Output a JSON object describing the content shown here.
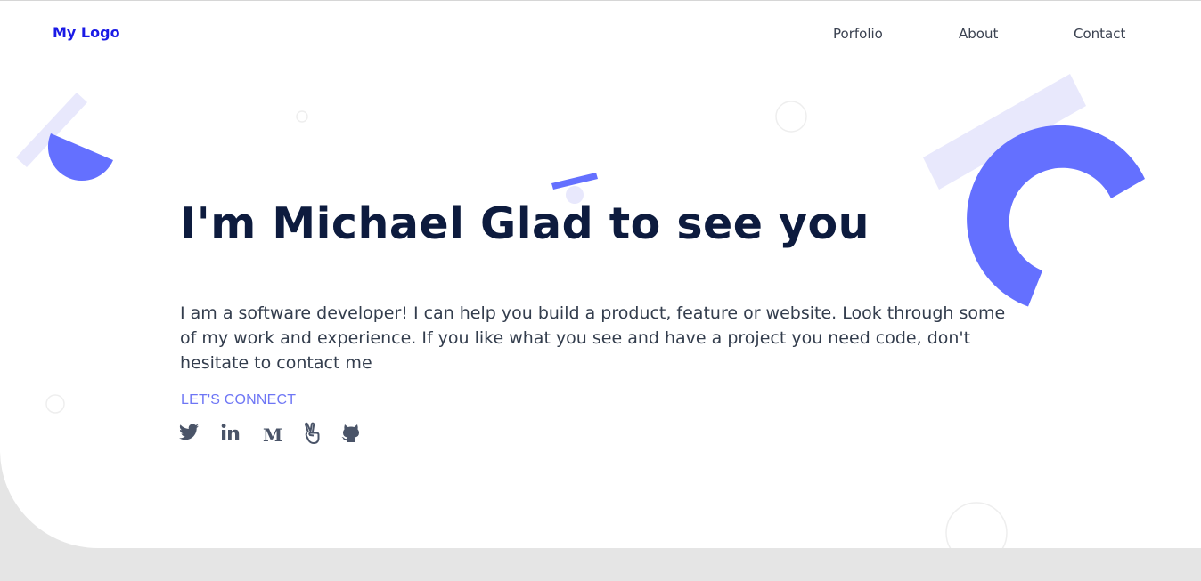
{
  "brand": {
    "logo_text": "My Logo"
  },
  "nav": {
    "items": [
      {
        "label": "Porfolio"
      },
      {
        "label": "About"
      },
      {
        "label": "Contact"
      }
    ]
  },
  "hero": {
    "headline": "I'm Michael Glad to see you",
    "intro": "I am a software developer! I can help you build a product, feature or website. Look through some of my work and experience. If you like what you see and have a project you need code, don't hesitate to contact me",
    "connect_label": "LET'S CONNECT"
  },
  "socials": [
    {
      "icon": "twitter-icon"
    },
    {
      "icon": "linkedin-icon"
    },
    {
      "icon": "medium-icon"
    },
    {
      "icon": "angellist-icon"
    },
    {
      "icon": "github-icon"
    }
  ],
  "colors": {
    "logo": "#1a1ae6",
    "headline": "#0d1b3e",
    "body_text": "#333d4d",
    "accent": "#6470ff",
    "accent_light": "#e8e8fc",
    "social_icon": "#4a5468",
    "page_background": "#e5e5e5"
  }
}
